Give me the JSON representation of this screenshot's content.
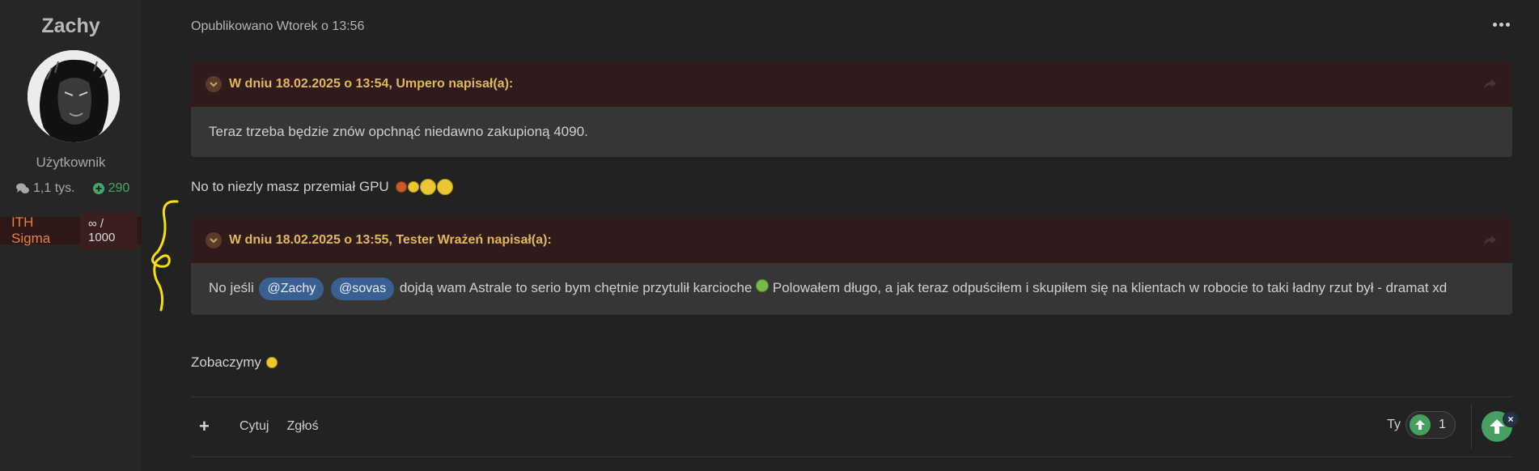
{
  "author": {
    "name": "Zachy",
    "role": "Użytkownik",
    "posts": "1,1 tys.",
    "reputation": "290",
    "rank_name": "ITH Sigma",
    "rank_count": "∞ / 1000"
  },
  "post": {
    "published": "Opublikowano Wtorek o 13:56",
    "quote1": {
      "title": "W dniu 18.02.2025 o 13:54, Umpero napisał(a):",
      "text": "Teraz trzeba będzie znów opchnąć niedawno zakupioną 4090."
    },
    "text1": "No to niezly masz przemiał GPU",
    "quote2": {
      "title": "W dniu 18.02.2025 o 13:55, Tester Wrażeń napisał(a):",
      "prefix": "No jeśli",
      "mention1": "@Zachy",
      "mention2": "@sovas",
      "suffix": "dojdą wam Astrale to serio bym chętnie przytulił karcioche",
      "continuation": "Polowałem długo, a jak teraz odpuściłem i skupiłem się na klientach w robocie to taki ładny rzut był - dramat xd"
    },
    "text2": "Zobaczymy"
  },
  "actions": {
    "quote": "Cytuj",
    "report": "Zgłoś",
    "reacted_by": "Ty",
    "vote_count": "1"
  },
  "colors": {
    "background": "#222222",
    "sidebar": "#262626",
    "quote_header": "#2f1a1c",
    "quote_title": "#e1b85a",
    "quote_body": "#363636",
    "mention": "#3a5f93",
    "reputation": "#3fa96b",
    "rank": "#e3833c",
    "upvote": "#48a060"
  },
  "icons": [
    "comments-icon",
    "plus-circle-icon",
    "chevron-down-icon",
    "share-icon",
    "more-dots-icon",
    "plus-icon",
    "upvote-icon",
    "close-icon",
    "emoji-icon"
  ]
}
